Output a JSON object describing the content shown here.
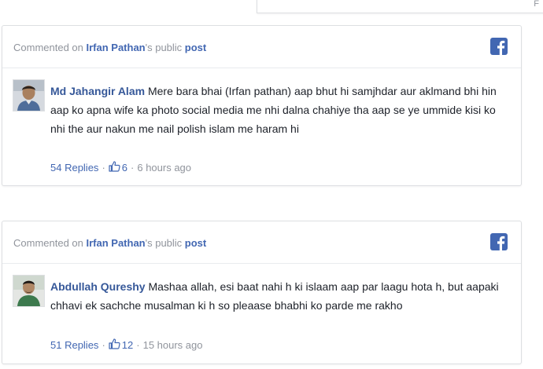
{
  "top_partial": {
    "text": "F"
  },
  "comments": [
    {
      "header_prefix": "Commented on ",
      "page_name": "Irfan Pathan",
      "header_middle": "'s public ",
      "header_link": "post",
      "author": "Md Jahangir Alam",
      "text": "Mere bara bhai (Irfan pathan) aap bhut hi samjhdar aur aklmand bhi hin aap ko apna wife ka photo social media me nhi dalna chahiye tha aap se ye ummide kisi ko nhi the aur nakun me nail polish islam me haram hi",
      "replies": "54 Replies",
      "likes": "6",
      "time": "6 hours ago"
    },
    {
      "header_prefix": "Commented on ",
      "page_name": "Irfan Pathan",
      "header_middle": "'s public ",
      "header_link": "post",
      "author": "Abdullah Qureshy",
      "text": "Mashaa allah, esi baat nahi h ki islaam aap par laagu hota h, but aapaki chhavi ek sachche musalman ki h so pleaase bhabhi ko parde me rakho",
      "replies": "51 Replies",
      "likes": "12",
      "time": "15 hours ago"
    }
  ],
  "separator": "·",
  "icons": {
    "facebook": "facebook-logo-icon",
    "like": "thumbs-up-icon"
  },
  "colors": {
    "link_blue": "#4267b2",
    "author_blue": "#365899",
    "meta_gray": "#90949c",
    "border": "#dddfe2"
  }
}
